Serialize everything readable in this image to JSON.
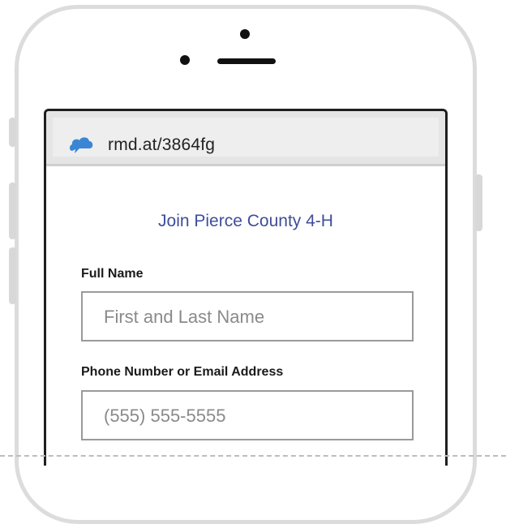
{
  "browser": {
    "url": "rmd.at/3864fg",
    "icon": "cloud-icon",
    "icon_color": "#3a86d4"
  },
  "form": {
    "title": "Join Pierce County 4-H",
    "title_color": "#3f4e9a",
    "fields": [
      {
        "label": "Full Name",
        "placeholder": "First and Last Name"
      },
      {
        "label": "Phone Number or Email Address",
        "placeholder": "(555) 555-5555"
      }
    ]
  }
}
